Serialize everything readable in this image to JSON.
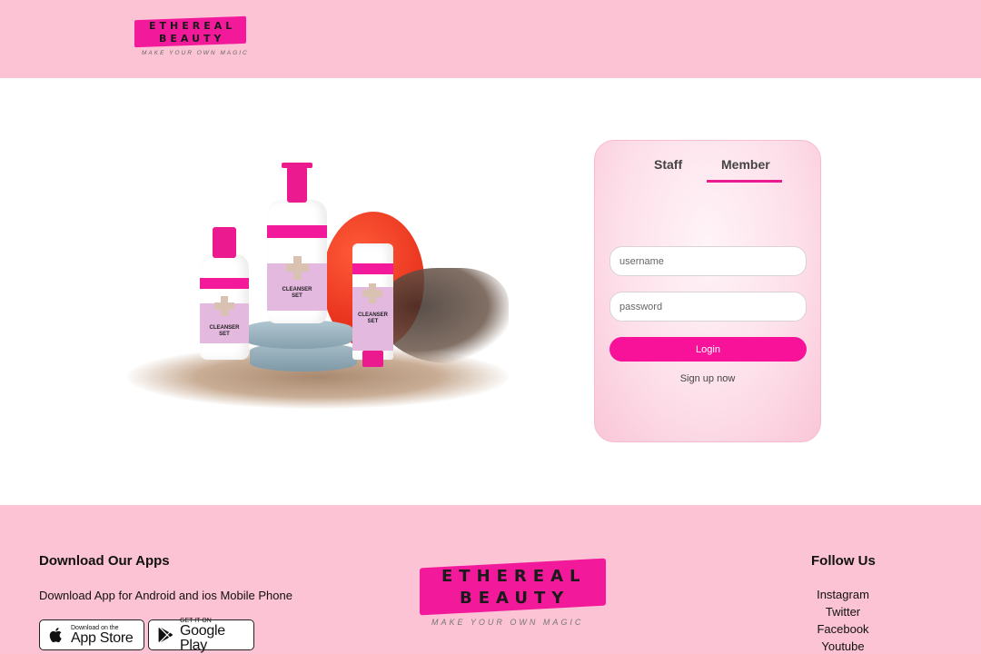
{
  "header": {
    "logo": {
      "line1": "ETHEREAL",
      "line2": "BEAUTY",
      "tagline": "MAKE YOUR OWN MAGIC"
    }
  },
  "hero": {
    "product_label": {
      "line1": "CLEANSER",
      "line2": "SET"
    },
    "colors": {
      "accent": "#f3199b",
      "disc": "#e52e1a"
    }
  },
  "login": {
    "tabs": [
      {
        "label": "Staff"
      },
      {
        "label": "Member"
      }
    ],
    "active_tab": "Member",
    "username": {
      "placeholder": "username",
      "value": ""
    },
    "password": {
      "placeholder": "password",
      "value": ""
    },
    "login_label": "Login",
    "signup_label": "Sign up now"
  },
  "footer": {
    "apps": {
      "title": "Download Our Apps",
      "description": "Download App for Android and ios Mobile Phone",
      "appstore": {
        "small": "Download on the",
        "big": "App Store",
        "icon": "apple-icon"
      },
      "googleplay": {
        "small": "GET IT ON",
        "big": "Google Play",
        "icon": "google-play-icon"
      }
    },
    "logo": {
      "line1": "ETHEREAL",
      "line2": "BEAUTY",
      "tagline": "MAKE YOUR OWN MAGIC"
    },
    "follow": {
      "title": "Follow Us",
      "links": [
        "Instagram",
        "Twitter",
        "Facebook",
        "Youtube"
      ]
    }
  },
  "theme": {
    "pink_bg": "#fbc3d4",
    "brand_pink": "#f8129a",
    "white": "#ffffff"
  }
}
